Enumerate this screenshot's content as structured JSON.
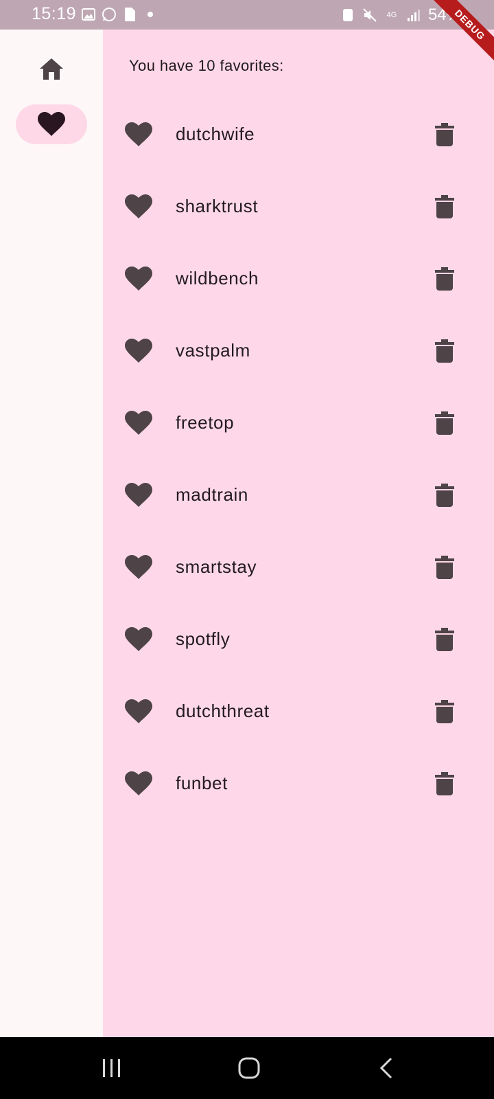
{
  "status_bar": {
    "time": "15:19",
    "battery": "54%",
    "network": "4G"
  },
  "debug_banner": "DEBUG",
  "nav_rail": {
    "items": [
      {
        "icon": "home-icon",
        "selected": false
      },
      {
        "icon": "heart-icon",
        "selected": true
      }
    ]
  },
  "favorites": {
    "count_text": "You have 10 favorites:",
    "items": [
      {
        "label": "dutchwife"
      },
      {
        "label": "sharktrust"
      },
      {
        "label": "wildbench"
      },
      {
        "label": "vastpalm"
      },
      {
        "label": "freetop"
      },
      {
        "label": "madtrain"
      },
      {
        "label": "smartstay"
      },
      {
        "label": "spotfly"
      },
      {
        "label": "dutchthreat"
      },
      {
        "label": "funbet"
      }
    ]
  },
  "colors": {
    "rail_bg": "#fdf7f8",
    "content_bg": "#fed8e8",
    "selected_pill": "#ffd8e8",
    "icon": "#4e4347",
    "status_bar": "#bea7b2"
  }
}
